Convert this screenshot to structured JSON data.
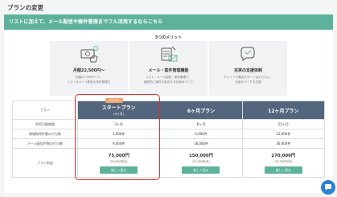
{
  "page": {
    "title": "プランの変更"
  },
  "banner": {
    "text": "リストに加えて、メール配信や案件管理までフル活用するならこちら"
  },
  "merits": {
    "title": "3つのメリット",
    "items": [
      {
        "icon": "money-icon",
        "title": "月額22,500円〜",
        "desc": "月額22,500円〜で、\nリスト＆メール配信＆案件管理も"
      },
      {
        "icon": "mail-management-icon",
        "title": "メール・案件管理機能",
        "desc": "リスト・メール配信・案件管理で、\n継続的に案件を創出する仕組みづくり"
      },
      {
        "icon": "support-icon",
        "title": "充実の支援体制",
        "desc": "チャットや電話サポートはもちろん、\n仕組みづくりも支援"
      }
    ]
  },
  "plans": {
    "header_label": "プラン",
    "badge": "おすすめ",
    "row_labels": [
      "利用可能期間",
      "情報取得件数の付与数",
      "メール配信件数の付与数",
      "プラン料金"
    ],
    "columns": [
      {
        "name": "スタートプラン",
        "sub": "(3ヶ月)",
        "period": "3ヶ月",
        "info": "3,000件",
        "mail": "9,000件",
        "price": "75,000円",
        "price_sub": "(25,000円/月)",
        "button": "新しく見る"
      },
      {
        "name": "6ヶ月プラン",
        "sub": "",
        "period": "6ヶ月",
        "info": "6,000件",
        "mail": "18,000件",
        "price": "150,000円",
        "price_sub": "(25,000円/月)",
        "button": "新しく見る"
      },
      {
        "name": "12ヶ月プラン",
        "sub": "",
        "period": "12ヶ月",
        "info": "12,000件",
        "mail": "36,000件",
        "price": "270,000円",
        "price_sub": "(22,500円/月)",
        "button": "新しく見る"
      }
    ]
  },
  "colors": {
    "accent": "#5eb29c",
    "header": "#53667e",
    "highlight": "#e02d2d",
    "chat": "#2b80d6",
    "badge": "#f0a36a"
  }
}
